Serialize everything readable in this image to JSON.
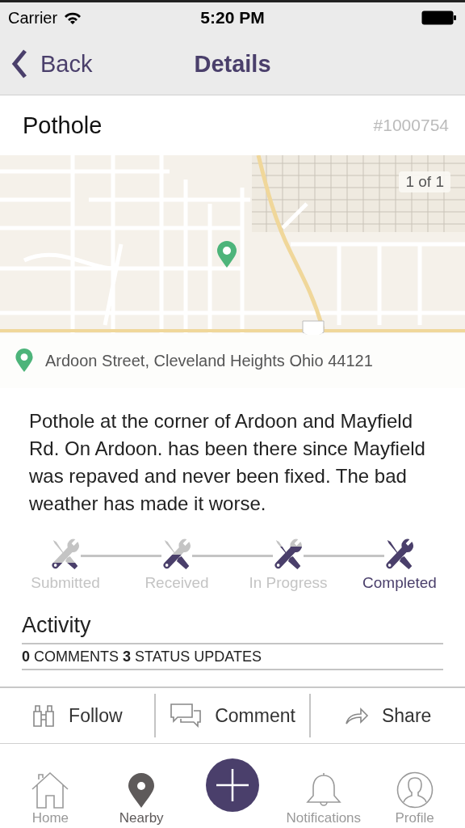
{
  "status_bar": {
    "carrier": "Carrier",
    "time": "5:20 PM"
  },
  "nav": {
    "back": "Back",
    "title": "Details"
  },
  "report": {
    "title": "Pothole",
    "number": "#1000754"
  },
  "map": {
    "kind": "picture",
    "counter": "1 of 1",
    "address": "Ardoon Street, Cleveland Heights Ohio 44121"
  },
  "description": "Pothole at the corner of Ardoon and Mayfield Rd. On Ardoon. has been there since Mayfield was repaved and never been fixed. The bad weather has made it worse.",
  "steps": [
    {
      "label": "Submitted",
      "level": 0.25,
      "selected": false
    },
    {
      "label": "Received",
      "level": 0.5,
      "selected": false
    },
    {
      "label": "In Progress",
      "level": 0.75,
      "selected": false
    },
    {
      "label": "Completed",
      "level": 1,
      "selected": true
    }
  ],
  "activity": {
    "title": "Activity",
    "summary": "**0** COMMENTS **3** STATUS UPDATES"
  },
  "actions": [
    {
      "kind": "follow",
      "label": "Follow"
    },
    {
      "kind": "comment",
      "label": "Comment"
    },
    {
      "kind": "share",
      "label": "Share"
    }
  ],
  "tabs": [
    {
      "kind": "home",
      "label": "Home",
      "selected": false
    },
    {
      "kind": "nearby",
      "label": "Nearby",
      "selected": true
    },
    {
      "kind": "add"
    },
    {
      "kind": "notifications",
      "label": "Notifications",
      "selected": false
    },
    {
      "kind": "profile",
      "label": "Profile",
      "selected": false
    }
  ]
}
